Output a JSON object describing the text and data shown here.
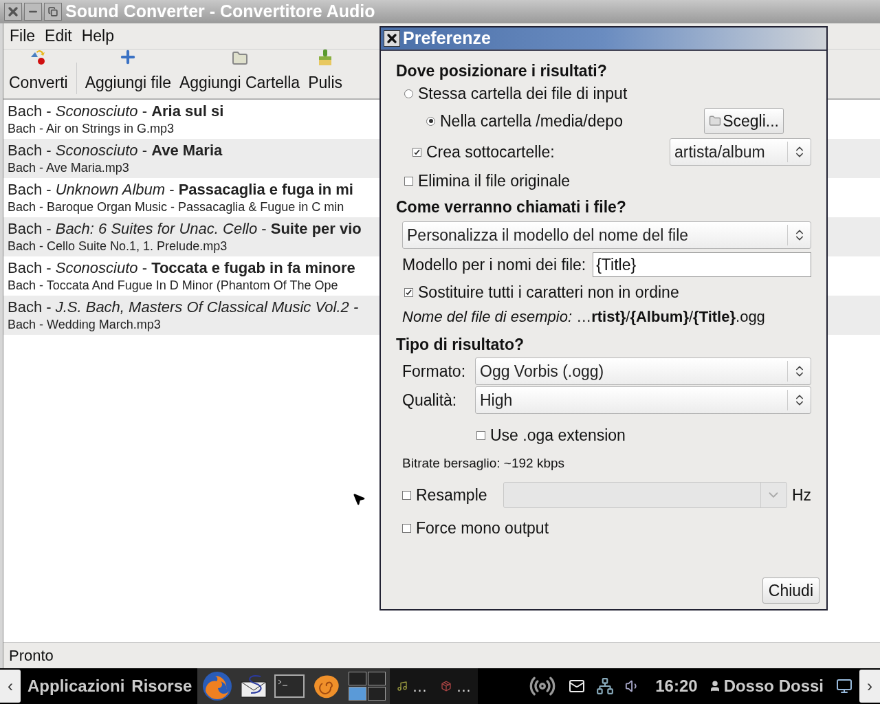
{
  "window": {
    "title": "Sound Converter - Convertitore Audio"
  },
  "menu": [
    "File",
    "Edit",
    "Help"
  ],
  "toolbar": [
    {
      "kind": "convert",
      "label": "Converti"
    },
    {
      "kind": "add",
      "label": "Aggiungi file"
    },
    {
      "kind": "folder",
      "label": "Aggiungi Cartella"
    },
    {
      "kind": "clear",
      "label": "Pulis"
    }
  ],
  "files": [
    {
      "title": "Bach - *Sconosciuto* - **Aria sul si**",
      "filename": "Bach - Air on Strings in G.mp3"
    },
    {
      "title": "Bach - *Sconosciuto* - **Ave Maria**",
      "filename": "Bach - Ave Maria.mp3"
    },
    {
      "title": "Bach - *Unknown Album* - **Passacaglia e fuga in mi**",
      "filename": "Bach - Baroque Organ Music - Passacaglia & Fugue in C min"
    },
    {
      "title": "Bach - *Bach: 6 Suites for Unac. Cello* - **Suite per vio**",
      "filename": "Bach - Cello Suite No.1, 1. Prelude.mp3"
    },
    {
      "title": "Bach - *Sconosciuto* - **Toccata e fugab in fa minore**",
      "filename": "Bach - Toccata And Fugue In D Minor (Phantom Of The Ope"
    },
    {
      "title": "Bach - *J.S. Bach, Masters Of Classical Music Vol.2 -*",
      "filename": "Bach - Wedding March.mp3"
    }
  ],
  "status_bar": "Pronto",
  "dialog": {
    "title": "Preferenze",
    "location": {
      "heading": "Dove posizionare i risultati?",
      "options": [
        {
          "label": "Stessa cartella dei file di input",
          "selected": false
        },
        {
          "label": "Nella cartella /media/depo",
          "selected": true
        }
      ],
      "choose_button": "Scegli...",
      "subfolders": {
        "label": "Crea sottocartelle:",
        "checked": true,
        "value": "artista/album"
      },
      "delete_original": {
        "label": "Elimina il file originale",
        "checked": false
      }
    },
    "naming": {
      "heading": "Come verranno chiamati i file?",
      "mode": "Personalizza il modello del nome del file",
      "pattern_label": "Modello per i nomi dei file:",
      "pattern_value": "{Title}",
      "replace_chars": {
        "label": "Sostituire tutti i caratteri non in ordine",
        "checked": true
      },
      "example": "*Nome del file di esempio:* …**rtist}**/**{Album}**/**{Title}**.ogg"
    },
    "result": {
      "heading": "Tipo di risultato?",
      "format": {
        "label": "Formato:",
        "value": "Ogg Vorbis (.ogg)"
      },
      "quality": {
        "label": "Qualità:",
        "value": "High"
      },
      "oga": {
        "label": "Use .oga extension",
        "checked": false
      },
      "bitrate": "Bitrate bersaglio: ~192 kbps",
      "resample": {
        "label": "Resample",
        "checked": false,
        "disabled": true,
        "unit": "Hz"
      },
      "mono": {
        "label": "Force mono output",
        "checked": false
      }
    },
    "close_button": "Chiudi"
  },
  "taskbar": {
    "left_arrow": "‹",
    "menus": [
      "Applicazioni",
      "Risorse"
    ],
    "launchers": [
      {
        "kind": "browser"
      },
      {
        "kind": "mail"
      },
      {
        "kind": "terminal"
      },
      {
        "kind": "shell"
      }
    ],
    "workspaces": [
      {
        "selected": false
      },
      {
        "selected": false
      },
      {
        "selected": true
      },
      {
        "selected": false
      }
    ],
    "tasks": [
      {
        "kind": "music",
        "label": "…"
      },
      {
        "kind": "package",
        "label": "…"
      }
    ],
    "clock": "16:20",
    "user": "Dosso Dossi",
    "right_arrow": "›"
  }
}
